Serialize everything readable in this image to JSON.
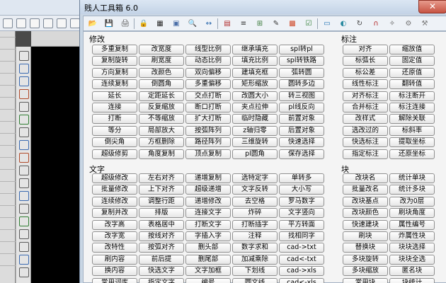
{
  "window": {
    "title": "贱人工具箱 6.0",
    "close_glyph": "✕"
  },
  "groups": {
    "modify": {
      "label": "修改",
      "rows": [
        [
          "多重复制",
          "改宽度",
          "线型比例",
          "继承填充",
          "spl转pl"
        ],
        [
          "复制旋转",
          "刷宽度",
          "动态比例",
          "填充比例",
          "spl转铁路"
        ],
        [
          "方向复制",
          "改颜色",
          "双向偏移",
          "建填充框",
          "弧转圆"
        ],
        [
          "连续复制",
          "倒圆角",
          "多重偏移",
          "矩形缩放",
          "圆转多边"
        ],
        [
          "延长",
          "定距延长",
          "交点打断",
          "改圆大小",
          "转三视图"
        ],
        [
          "连接",
          "反复缩放",
          "断口打断",
          "夹点拉伸",
          "pl线反向"
        ],
        [
          "打断",
          "不等缩放",
          "扩大打断",
          "临时隐藏",
          "前置对象"
        ],
        [
          "等分",
          "局部放大",
          "按弧阵列",
          "z轴归零",
          "后置对象"
        ],
        [
          "倒尖角",
          "方框删除",
          "路径阵列",
          "三维旋转",
          "快速选择"
        ],
        [
          "超级修剪",
          "角度复制",
          "顶点复制",
          "pl圆角",
          "保存选择"
        ]
      ]
    },
    "annotate": {
      "label": "标注",
      "rows": [
        [
          "对齐",
          "缩放值"
        ],
        [
          "标弧长",
          "固定值"
        ],
        [
          "标公差",
          "还原值"
        ],
        [
          "线性标注",
          "翻转值"
        ],
        [
          "对齐标注",
          "标注断开"
        ],
        [
          "合并标注",
          "标注连接"
        ],
        [
          "改样式",
          "解除关联"
        ],
        [
          "选改过的",
          "标斜率"
        ],
        [
          "快选标注",
          "提取坐标"
        ],
        [
          "指定标注",
          "还原坐标"
        ]
      ]
    },
    "text": {
      "label": "文字",
      "rows": [
        [
          "超级修改",
          "左右对齐",
          "递增复制",
          "选特定字",
          "单转多"
        ],
        [
          "批量修改",
          "上下对齐",
          "超级递增",
          "文字反转",
          "大小写"
        ],
        [
          "连续修改",
          "调整行距",
          "递增修改",
          "去空格",
          "罗马数字"
        ],
        [
          "复制并改",
          "排版",
          "连接文字",
          "炸碎",
          "文字竖向"
        ],
        [
          "改字高",
          "表格居中",
          "打断文字",
          "打断插字",
          "平方转面"
        ],
        [
          "改字宽",
          "按线对齐",
          "字插入字",
          "注释",
          "找相同字"
        ],
        [
          "改特性",
          "按弧对齐",
          "删头部",
          "数字求和",
          "cad->txt"
        ],
        [
          "刷内容",
          "前后提",
          "删尾部",
          "加减乘除",
          "cad<-txt"
        ],
        [
          "换内容",
          "快选文字",
          "文字加框",
          "下划线",
          "cad->xls"
        ],
        [
          "常用词库",
          "指定文字",
          "编号",
          "圆文线",
          "cad<-xls"
        ]
      ]
    },
    "block": {
      "label": "块",
      "rows": [
        [
          "改块名",
          "统计单块"
        ],
        [
          "批量改名",
          "统计多块"
        ],
        [
          "改块基点",
          "改为0层"
        ],
        [
          "改块颜色",
          "刷块角度"
        ],
        [
          "快速建块",
          "属性编号"
        ],
        [
          "刷块",
          "炸属性块"
        ],
        [
          "替换块",
          "块块选择"
        ],
        [
          "多块旋转",
          "块块全选"
        ],
        [
          "多块缩放",
          "匿名块"
        ],
        [
          "常用块",
          "块统计"
        ]
      ]
    }
  },
  "toolbar_icons": [
    {
      "name": "open-folder-icon",
      "glyph": "📂",
      "color": "#d9a928"
    },
    {
      "name": "save-icon",
      "glyph": "💾",
      "color": "#3a65b0"
    },
    {
      "name": "print-icon",
      "glyph": "🖨",
      "color": "#555555"
    },
    {
      "name": "lock-icon",
      "glyph": "🔒",
      "color": "#c89b2a"
    },
    {
      "name": "table-icon",
      "glyph": "▦",
      "color": "#2a2a2a"
    },
    {
      "name": "image-icon",
      "glyph": "▣",
      "color": "#4b6fa8"
    },
    {
      "name": "zoom-icon",
      "glyph": "🔍",
      "color": "#444444"
    },
    {
      "name": "measure-icon",
      "glyph": "↔",
      "color": "#1f5fa8"
    },
    {
      "name": "layer-icon",
      "glyph": "▤",
      "color": "#b12a2a"
    },
    {
      "name": "align-icon",
      "glyph": "≡",
      "color": "#333333"
    },
    {
      "name": "block-insert-icon",
      "glyph": "⊞",
      "color": "#3a7a3a"
    },
    {
      "name": "edit-text-icon",
      "glyph": "✎",
      "color": "#333333"
    },
    {
      "name": "color-grid-icon",
      "glyph": "▩",
      "color": "#d04a2a"
    },
    {
      "name": "checklist-icon",
      "glyph": "☑",
      "color": "#2f7d32"
    },
    {
      "name": "monitor-icon",
      "glyph": "▭",
      "color": "#1b6fb0"
    },
    {
      "name": "palette-icon",
      "glyph": "◐",
      "color": "#2a8aa0"
    },
    {
      "name": "rotate-icon",
      "glyph": "↻",
      "color": "#444444"
    },
    {
      "name": "magnet-icon",
      "glyph": "∩",
      "color": "#b02020"
    },
    {
      "name": "snap-icon",
      "glyph": "✧",
      "color": "#555555"
    },
    {
      "name": "gear-icon",
      "glyph": "⚙",
      "color": "#777777"
    },
    {
      "name": "settings-icon",
      "glyph": "⚒",
      "color": "#777777"
    }
  ]
}
